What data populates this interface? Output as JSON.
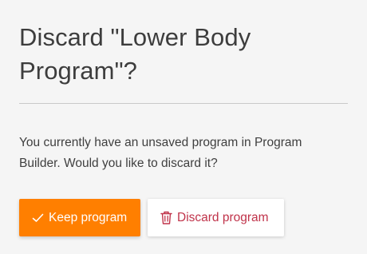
{
  "dialog": {
    "title": "Discard \"Lower Body Program\"?",
    "message": "You currently have an unsaved program in Program Builder. Would you like to discard it?",
    "primary_button": {
      "label": "Keep program",
      "icon": "check-icon",
      "color": "#ff7f00"
    },
    "secondary_button": {
      "label": "Discard program",
      "icon": "trash-icon",
      "color": "#c0334a"
    }
  }
}
